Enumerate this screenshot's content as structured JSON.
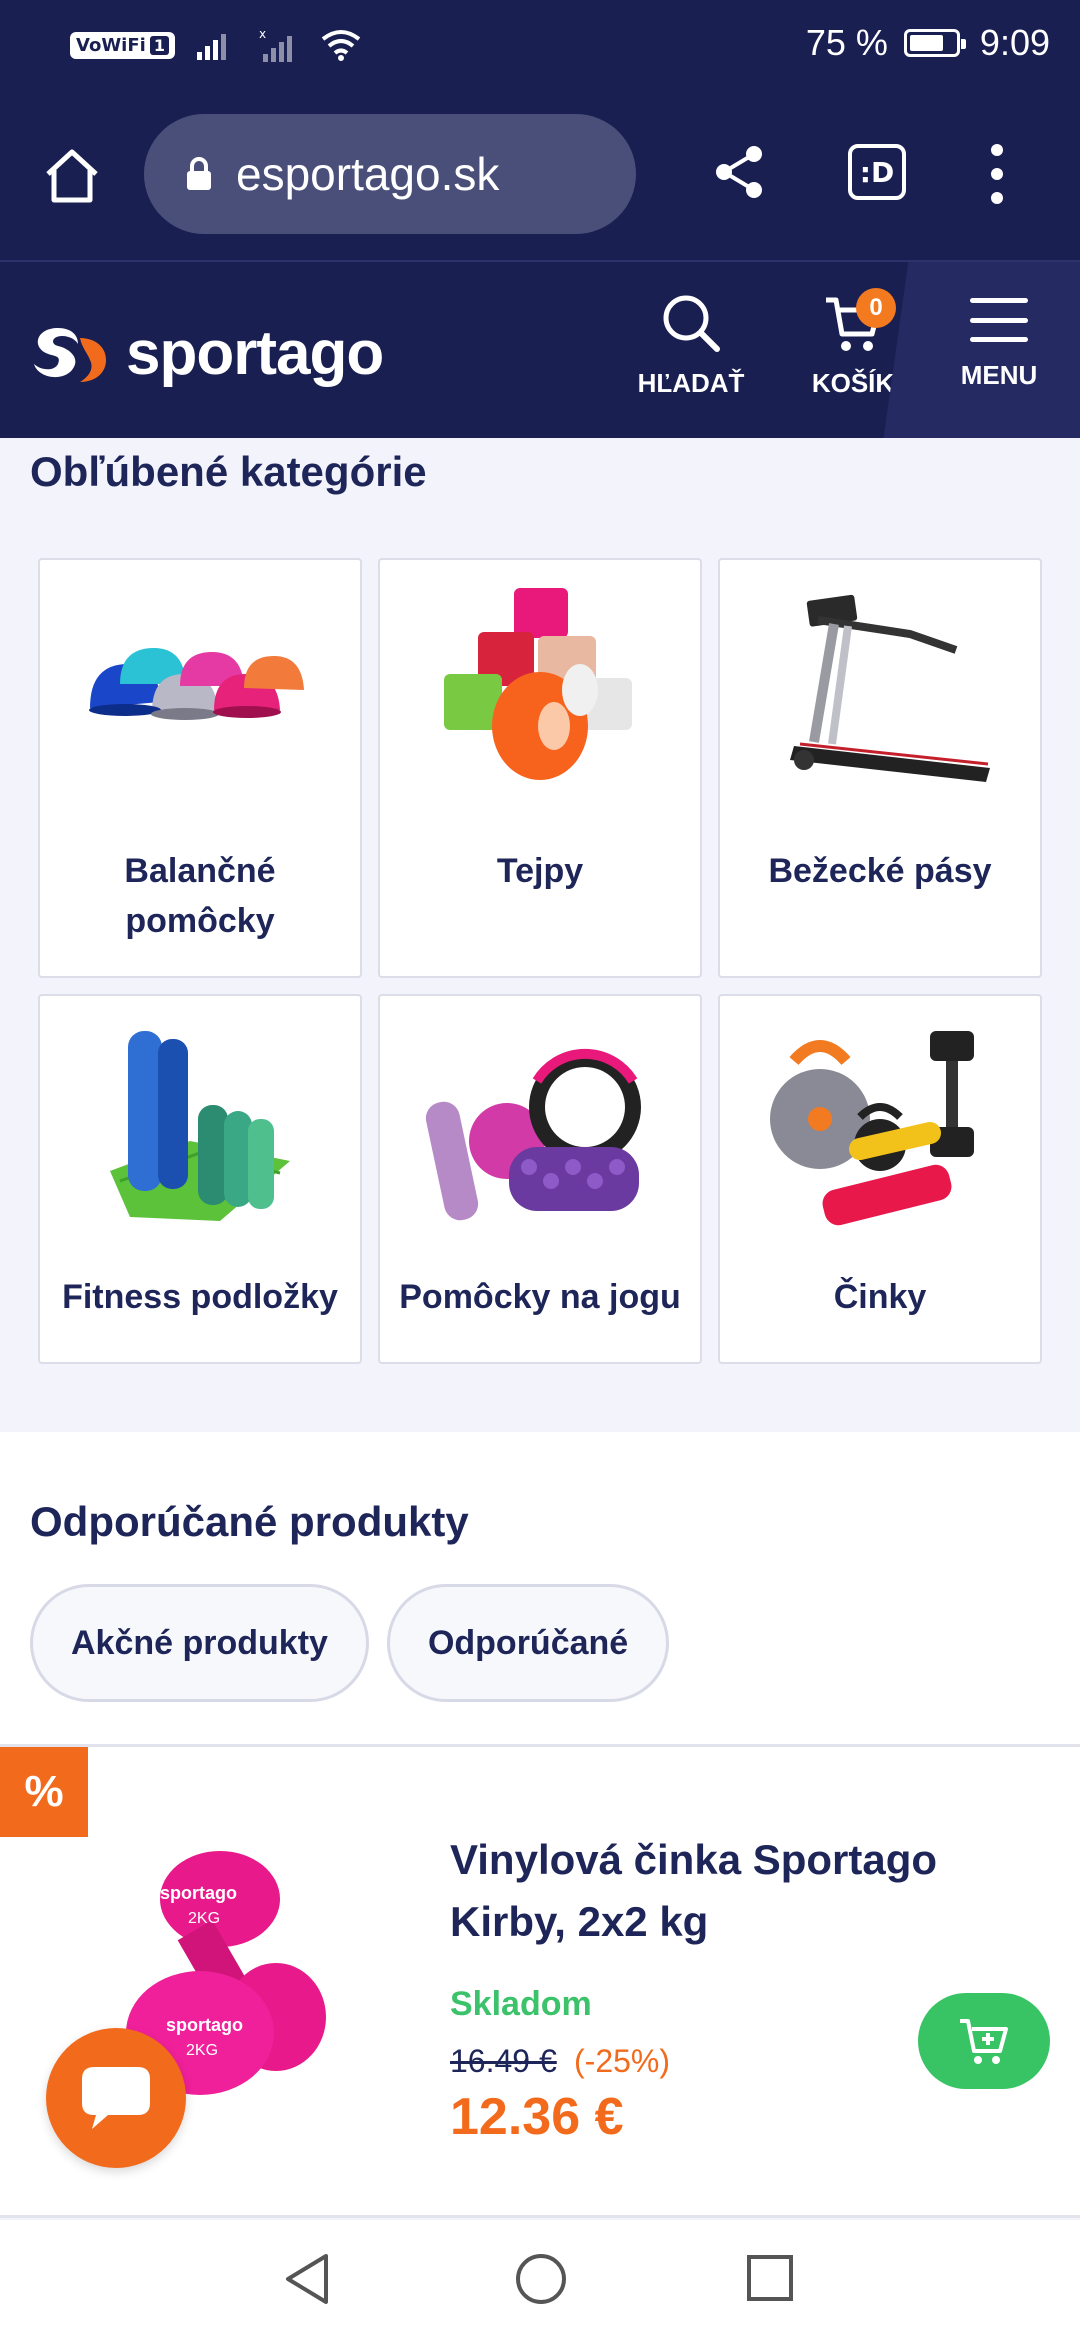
{
  "status_bar": {
    "vowifi": "VoWiFi",
    "sim": "1",
    "battery_text": "75 %",
    "battery_level": 0.75,
    "time": "9:09"
  },
  "browser": {
    "url": "esportago.sk",
    "tab_icon": ":D"
  },
  "header": {
    "logo_text": "sportago",
    "search_label": "HĽADAŤ",
    "cart_label": "KOŠÍK",
    "cart_count": "0",
    "menu_label": "MENU"
  },
  "categories": {
    "title": "Obľúbené kategórie",
    "items": [
      {
        "label": "Balančné pomôcky",
        "icon": "balance-domes-image"
      },
      {
        "label": "Tejpy",
        "icon": "kinesio-tapes-image"
      },
      {
        "label": "Bežecké pásy",
        "icon": "treadmill-image"
      },
      {
        "label": "Fitness podložky",
        "icon": "fitness-mats-image"
      },
      {
        "label": "Pomôcky na jogu",
        "icon": "yoga-accessories-image"
      },
      {
        "label": "Činky",
        "icon": "dumbbells-image"
      }
    ]
  },
  "recommended": {
    "title": "Odporúčané produkty",
    "tabs": [
      {
        "label": "Akčné produkty"
      },
      {
        "label": "Odporúčané"
      }
    ]
  },
  "product": {
    "badge": "%",
    "name": "Vinylová činka Sportago Kirby, 2x2 kg",
    "stock": "Skladom",
    "old_price": "16.49 €",
    "discount": "(-25%)",
    "price": "12.36 €",
    "dumbbell_label": "sportago",
    "dumbbell_weight": "2KG"
  },
  "colors": {
    "navy": "#1a1f52",
    "orange": "#f26b1d",
    "green": "#38c464"
  }
}
